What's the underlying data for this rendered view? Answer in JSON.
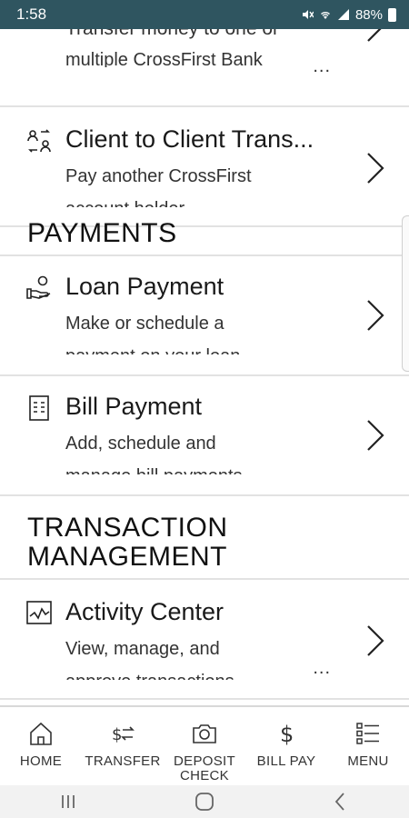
{
  "status_bar": {
    "time": "1:58",
    "battery": "88%",
    "icons": [
      "mute-icon",
      "wifi-icon",
      "signal-icon",
      "battery-icon"
    ]
  },
  "cards": {
    "transfer_multiple": {
      "title": "Transfer money to one or",
      "desc": "multiple CrossFirst Bank",
      "more": "..."
    },
    "client_transfer": {
      "title": "Client to Client Trans...",
      "desc_line1": "Pay another CrossFirst",
      "desc_line2": "account holder",
      "icon": "client-transfer-icon"
    },
    "loan_payment": {
      "title": "Loan Payment",
      "desc_line1": "Make or schedule a",
      "desc_line2": "payment on your loan",
      "icon": "loan-hand-icon"
    },
    "bill_payment": {
      "title": "Bill Payment",
      "desc_line1": "Add, schedule and",
      "desc_line2": "manage bill payments",
      "icon": "bill-icon"
    },
    "activity_center": {
      "title": "Activity Center",
      "desc_line1": "View, manage, and",
      "desc_line2": "approve transactions",
      "more": "...",
      "icon": "activity-chart-icon"
    }
  },
  "sections": {
    "payments": "PAYMENTS",
    "transaction_line1": "TRANSACTION",
    "transaction_line2": "MANAGEMENT"
  },
  "bottom_nav": {
    "home": "HOME",
    "transfer": "TRANSFER",
    "deposit_line1": "DEPOSIT",
    "deposit_line2": "CHECK",
    "bill_pay": "BILL PAY",
    "menu": "MENU"
  },
  "colors": {
    "status_bar": "#2f5560",
    "divider": "#e2e2e2",
    "text": "#111111"
  }
}
